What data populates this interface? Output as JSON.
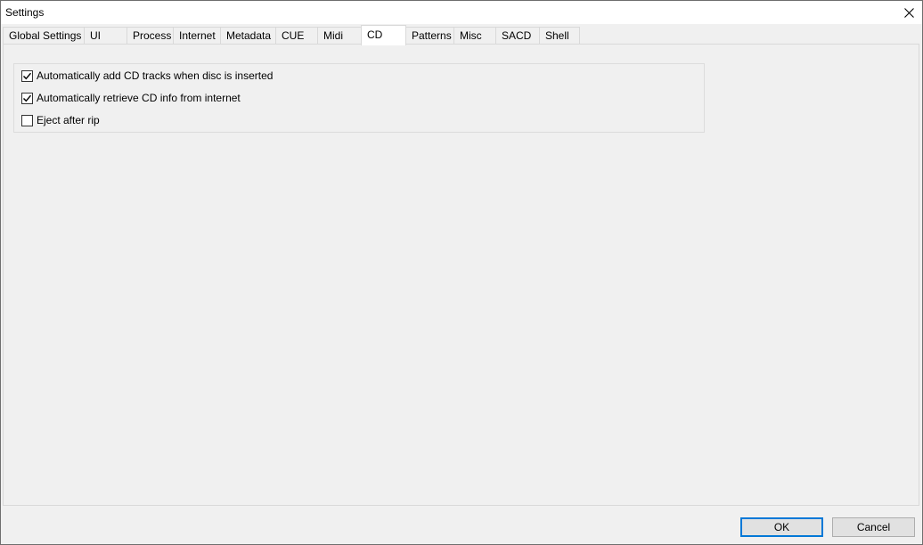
{
  "window": {
    "title": "Settings"
  },
  "tabs": [
    {
      "label": "Global Settings",
      "active": false
    },
    {
      "label": "UI",
      "active": false
    },
    {
      "label": "Process",
      "active": false
    },
    {
      "label": "Internet",
      "active": false
    },
    {
      "label": "Metadata",
      "active": false
    },
    {
      "label": "CUE",
      "active": false
    },
    {
      "label": "Midi",
      "active": false
    },
    {
      "label": "CD",
      "active": true
    },
    {
      "label": "Patterns",
      "active": false
    },
    {
      "label": "Misc",
      "active": false
    },
    {
      "label": "SACD",
      "active": false
    },
    {
      "label": "Shell",
      "active": false
    }
  ],
  "cd_options": [
    {
      "label": "Automatically add CD tracks when disc is inserted",
      "checked": true
    },
    {
      "label": "Automatically retrieve CD info from internet",
      "checked": true
    },
    {
      "label": "Eject after rip",
      "checked": false
    }
  ],
  "footer": {
    "ok_label": "OK",
    "cancel_label": "Cancel"
  },
  "icons": {
    "close": "close-icon",
    "check": "checkmark-icon"
  },
  "colors": {
    "accent": "#0078d7",
    "panel_bg": "#f0f0f0",
    "titlebar_bg": "#ffffff"
  }
}
